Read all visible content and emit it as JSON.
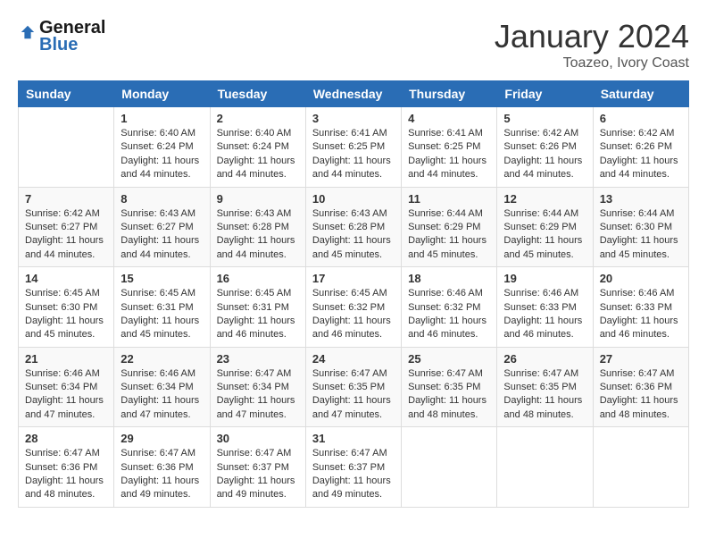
{
  "header": {
    "logo_line1": "General",
    "logo_line2": "Blue",
    "month": "January 2024",
    "location": "Toazeо, Ivory Coast"
  },
  "weekdays": [
    "Sunday",
    "Monday",
    "Tuesday",
    "Wednesday",
    "Thursday",
    "Friday",
    "Saturday"
  ],
  "weeks": [
    [
      {
        "day": "",
        "info": ""
      },
      {
        "day": "1",
        "info": "Sunrise: 6:40 AM\nSunset: 6:24 PM\nDaylight: 11 hours\nand 44 minutes."
      },
      {
        "day": "2",
        "info": "Sunrise: 6:40 AM\nSunset: 6:24 PM\nDaylight: 11 hours\nand 44 minutes."
      },
      {
        "day": "3",
        "info": "Sunrise: 6:41 AM\nSunset: 6:25 PM\nDaylight: 11 hours\nand 44 minutes."
      },
      {
        "day": "4",
        "info": "Sunrise: 6:41 AM\nSunset: 6:25 PM\nDaylight: 11 hours\nand 44 minutes."
      },
      {
        "day": "5",
        "info": "Sunrise: 6:42 AM\nSunset: 6:26 PM\nDaylight: 11 hours\nand 44 minutes."
      },
      {
        "day": "6",
        "info": "Sunrise: 6:42 AM\nSunset: 6:26 PM\nDaylight: 11 hours\nand 44 minutes."
      }
    ],
    [
      {
        "day": "7",
        "info": ""
      },
      {
        "day": "8",
        "info": "Sunrise: 6:43 AM\nSunset: 6:27 PM\nDaylight: 11 hours\nand 44 minutes."
      },
      {
        "day": "9",
        "info": "Sunrise: 6:43 AM\nSunset: 6:28 PM\nDaylight: 11 hours\nand 44 minutes."
      },
      {
        "day": "10",
        "info": "Sunrise: 6:43 AM\nSunset: 6:28 PM\nDaylight: 11 hours\nand 45 minutes."
      },
      {
        "day": "11",
        "info": "Sunrise: 6:44 AM\nSunset: 6:29 PM\nDaylight: 11 hours\nand 45 minutes."
      },
      {
        "day": "12",
        "info": "Sunrise: 6:44 AM\nSunset: 6:29 PM\nDaylight: 11 hours\nand 45 minutes."
      },
      {
        "day": "13",
        "info": "Sunrise: 6:44 AM\nSunset: 6:30 PM\nDaylight: 11 hours\nand 45 minutes."
      }
    ],
    [
      {
        "day": "14",
        "info": ""
      },
      {
        "day": "15",
        "info": "Sunrise: 6:45 AM\nSunset: 6:31 PM\nDaylight: 11 hours\nand 45 minutes."
      },
      {
        "day": "16",
        "info": "Sunrise: 6:45 AM\nSunset: 6:31 PM\nDaylight: 11 hours\nand 46 minutes."
      },
      {
        "day": "17",
        "info": "Sunrise: 6:45 AM\nSunset: 6:32 PM\nDaylight: 11 hours\nand 46 minutes."
      },
      {
        "day": "18",
        "info": "Sunrise: 6:46 AM\nSunset: 6:32 PM\nDaylight: 11 hours\nand 46 minutes."
      },
      {
        "day": "19",
        "info": "Sunrise: 6:46 AM\nSunset: 6:33 PM\nDaylight: 11 hours\nand 46 minutes."
      },
      {
        "day": "20",
        "info": "Sunrise: 6:46 AM\nSunset: 6:33 PM\nDaylight: 11 hours\nand 46 minutes."
      }
    ],
    [
      {
        "day": "21",
        "info": ""
      },
      {
        "day": "22",
        "info": "Sunrise: 6:46 AM\nSunset: 6:34 PM\nDaylight: 11 hours\nand 47 minutes."
      },
      {
        "day": "23",
        "info": "Sunrise: 6:47 AM\nSunset: 6:34 PM\nDaylight: 11 hours\nand 47 minutes."
      },
      {
        "day": "24",
        "info": "Sunrise: 6:47 AM\nSunset: 6:35 PM\nDaylight: 11 hours\nand 47 minutes."
      },
      {
        "day": "25",
        "info": "Sunrise: 6:47 AM\nSunset: 6:35 PM\nDaylight: 11 hours\nand 48 minutes."
      },
      {
        "day": "26",
        "info": "Sunrise: 6:47 AM\nSunset: 6:35 PM\nDaylight: 11 hours\nand 48 minutes."
      },
      {
        "day": "27",
        "info": "Sunrise: 6:47 AM\nSunset: 6:36 PM\nDaylight: 11 hours\nand 48 minutes."
      }
    ],
    [
      {
        "day": "28",
        "info": "Sunrise: 6:47 AM\nSunset: 6:36 PM\nDaylight: 11 hours\nand 48 minutes."
      },
      {
        "day": "29",
        "info": "Sunrise: 6:47 AM\nSunset: 6:36 PM\nDaylight: 11 hours\nand 49 minutes."
      },
      {
        "day": "30",
        "info": "Sunrise: 6:47 AM\nSunset: 6:37 PM\nDaylight: 11 hours\nand 49 minutes."
      },
      {
        "day": "31",
        "info": "Sunrise: 6:47 AM\nSunset: 6:37 PM\nDaylight: 11 hours\nand 49 minutes."
      },
      {
        "day": "",
        "info": ""
      },
      {
        "day": "",
        "info": ""
      },
      {
        "day": "",
        "info": ""
      }
    ]
  ],
  "week1_row1_day7_info": "Sunrise: 6:42 AM\nSunset: 6:27 PM\nDaylight: 11 hours\nand 44 minutes.",
  "week3_row3_day14_info": "Sunrise: 6:45 AM\nSunset: 6:30 PM\nDaylight: 11 hours\nand 45 minutes.",
  "week4_row4_day21_info": "Sunrise: 6:46 AM\nSunset: 6:34 PM\nDaylight: 11 hours\nand 47 minutes."
}
